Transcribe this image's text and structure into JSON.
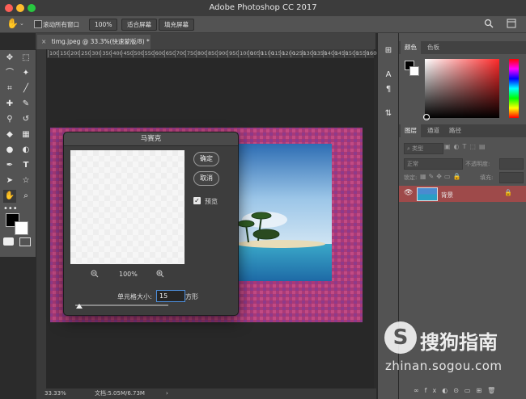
{
  "app": {
    "title": "Adobe Photoshop CC 2017"
  },
  "options": {
    "scroll_all_label": "滚动所有窗口",
    "zoom_100_label": "100%",
    "fit_screen_label": "适合屏幕",
    "fill_screen_label": "填充屏幕"
  },
  "document": {
    "tab_label": "timg.jpeg @ 33.3%(快速蒙版/8) *",
    "ruler_ticks": [
      "100",
      "150",
      "200",
      "250",
      "300",
      "350",
      "400",
      "450",
      "500",
      "550",
      "600",
      "650",
      "700",
      "750",
      "800",
      "850",
      "900",
      "950",
      "1000",
      "1050",
      "1100",
      "1150",
      "1200",
      "1250",
      "1300",
      "1350",
      "1400",
      "1450",
      "1500",
      "1550",
      "1600"
    ],
    "zoom": "33.33%",
    "doc_info": "文档:5.05M/6.73M"
  },
  "mosaic_dialog": {
    "title": "马赛克",
    "ok_label": "确定",
    "cancel_label": "取消",
    "preview_label": "预览",
    "preview_checked": true,
    "zoom_level": "100%",
    "cell_size_label": "单元格大小:",
    "cell_size_value": "15",
    "cell_unit": "方形"
  },
  "color_panel": {
    "tabs": [
      "颜色",
      "色板"
    ],
    "foreground": "#000000",
    "background": "#ffffff",
    "hue": "#ff2a2a"
  },
  "layers_panel": {
    "tabs": [
      "图层",
      "通道",
      "路径"
    ],
    "filter_label": "类型",
    "blend_mode": "正常",
    "opacity_label": "不透明度:",
    "lock_label": "锁定:",
    "fill_label": "填充:",
    "layers": [
      {
        "name": "背景",
        "visible": true,
        "locked": true
      }
    ]
  },
  "watermark": {
    "brand": "搜狗指南",
    "url": "zhinan.sogou.com"
  },
  "colors": {
    "accent": "#2d72c4",
    "quick_mask": "#b03060"
  }
}
